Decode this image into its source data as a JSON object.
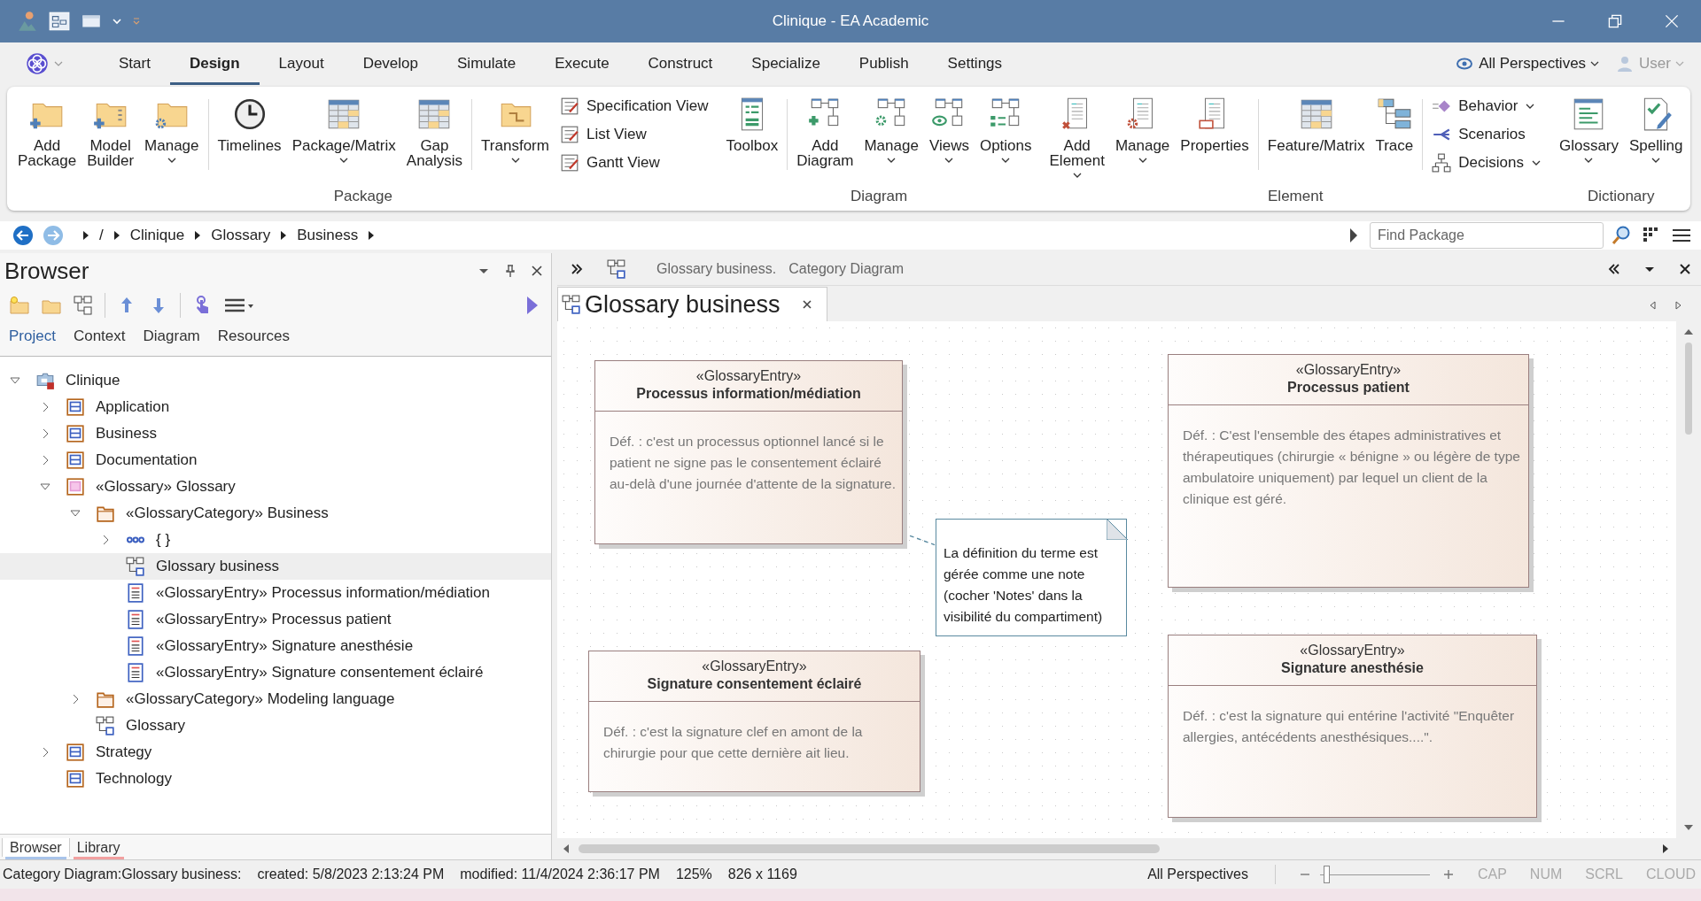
{
  "window": {
    "title": "Clinique - EA Academic"
  },
  "ribbon_tabs": [
    {
      "label": "Start",
      "selected": false
    },
    {
      "label": "Design",
      "selected": true
    },
    {
      "label": "Layout",
      "selected": false
    },
    {
      "label": "Develop",
      "selected": false
    },
    {
      "label": "Simulate",
      "selected": false
    },
    {
      "label": "Execute",
      "selected": false
    },
    {
      "label": "Construct",
      "selected": false
    },
    {
      "label": "Specialize",
      "selected": false
    },
    {
      "label": "Publish",
      "selected": false
    },
    {
      "label": "Settings",
      "selected": false
    }
  ],
  "perspective": "All Perspectives",
  "user": "User",
  "ribbon_groups": [
    {
      "label": "Package",
      "items": [
        {
          "kind": "large",
          "label": "Add Package",
          "menu": false
        },
        {
          "kind": "large",
          "label": "Model Builder",
          "menu": false
        },
        {
          "kind": "large",
          "label": "Manage",
          "menu": true
        },
        {
          "kind": "separator"
        },
        {
          "kind": "large",
          "label": "Timelines",
          "menu": false
        },
        {
          "kind": "large",
          "label": "Package/Matrix",
          "menu": true
        },
        {
          "kind": "large",
          "label": "Gap Analysis",
          "menu": false
        },
        {
          "kind": "separator"
        },
        {
          "kind": "large",
          "label": "Transform",
          "menu": true
        },
        {
          "kind": "stack",
          "items": [
            {
              "label": "Specification View",
              "menu": false
            },
            {
              "label": "List View",
              "menu": false
            },
            {
              "label": "Gantt View",
              "menu": false
            }
          ]
        }
      ]
    },
    {
      "label": "Diagram",
      "items": [
        {
          "kind": "large",
          "label": "Toolbox",
          "menu": false
        },
        {
          "kind": "separator"
        },
        {
          "kind": "large",
          "label": "Add Diagram",
          "menu": false
        },
        {
          "kind": "large",
          "label": "Manage",
          "menu": true
        },
        {
          "kind": "large",
          "label": "Views",
          "menu": true
        },
        {
          "kind": "large",
          "label": "Options",
          "menu": true
        }
      ]
    },
    {
      "label": "Element",
      "items": [
        {
          "kind": "large",
          "label": "Add Element",
          "menu": true
        },
        {
          "kind": "large",
          "label": "Manage",
          "menu": true
        },
        {
          "kind": "large",
          "label": "Properties",
          "menu": false
        },
        {
          "kind": "separator"
        },
        {
          "kind": "large",
          "label": "Feature/Matrix",
          "menu": false
        },
        {
          "kind": "large",
          "label": "Trace",
          "menu": false
        },
        {
          "kind": "separator"
        },
        {
          "kind": "stack",
          "items": [
            {
              "label": "Behavior",
              "menu": true
            },
            {
              "label": "Scenarios",
              "menu": false
            },
            {
              "label": "Decisions",
              "menu": true
            }
          ]
        }
      ]
    },
    {
      "label": "Dictionary",
      "items": [
        {
          "kind": "large",
          "label": "Glossary",
          "menu": true
        },
        {
          "kind": "large",
          "label": "Spelling",
          "menu": true
        }
      ]
    }
  ],
  "breadcrumb": [
    "/",
    "Clinique",
    "Glossary",
    "Business"
  ],
  "find_package": {
    "placeholder": "Find Package"
  },
  "browser": {
    "title": "Browser",
    "tabs": [
      {
        "label": "Project",
        "selected": true
      },
      {
        "label": "Context",
        "selected": false
      },
      {
        "label": "Diagram",
        "selected": false
      },
      {
        "label": "Resources",
        "selected": false
      }
    ],
    "tree": [
      {
        "kind": "model",
        "label": "Clinique",
        "expanded": true,
        "selected": false,
        "children": [
          {
            "kind": "package",
            "label": "Application",
            "expanded": false,
            "selected": false
          },
          {
            "kind": "package",
            "label": "Business",
            "expanded": false,
            "selected": false
          },
          {
            "kind": "package",
            "label": "Documentation",
            "expanded": false,
            "selected": false
          },
          {
            "kind": "glossary",
            "label": "«Glossary» Glossary",
            "expanded": true,
            "selected": false,
            "children": [
              {
                "kind": "category",
                "label": "«GlossaryCategory» Business",
                "expanded": true,
                "selected": false,
                "children": [
                  {
                    "kind": "group",
                    "label": "{ }",
                    "expanded": false,
                    "selected": false
                  },
                  {
                    "kind": "diagram",
                    "label": "Glossary business",
                    "selected": true
                  },
                  {
                    "kind": "entry",
                    "label": "«GlossaryEntry» Processus information/médiation",
                    "selected": false
                  },
                  {
                    "kind": "entry",
                    "label": "«GlossaryEntry» Processus patient",
                    "selected": false
                  },
                  {
                    "kind": "entry",
                    "label": "«GlossaryEntry» Signature anesthésie",
                    "selected": false
                  },
                  {
                    "kind": "entry",
                    "label": "«GlossaryEntry» Signature consentement éclairé",
                    "selected": false
                  }
                ]
              },
              {
                "kind": "category",
                "label": "«GlossaryCategory» Modeling language",
                "expanded": false,
                "selected": false
              },
              {
                "kind": "diagram",
                "label": "Glossary",
                "selected": false
              }
            ]
          },
          {
            "kind": "package",
            "label": "Strategy",
            "expanded": false,
            "selected": false
          },
          {
            "kind": "package",
            "label": "Technology",
            "selected": false
          }
        ]
      }
    ],
    "bottom_tabs": [
      {
        "label": "Browser",
        "selected": true,
        "color": "#a9c4ea"
      },
      {
        "label": "Library",
        "selected": false,
        "color": "#f2a0a0"
      }
    ]
  },
  "diagram": {
    "caption": "Glossary business.",
    "type": "Category Diagram",
    "tab": "Glossary business",
    "entries": [
      {
        "stereotype": "«GlossaryEntry»",
        "name": "Processus information/médiation",
        "definition": "Déf. : c'est un processus optionnel lancé si le patient ne signe pas le consentement éclairé au-delà d'une journée d'attente de la signature."
      },
      {
        "stereotype": "«GlossaryEntry»",
        "name": "Signature consentement éclairé",
        "definition": "Déf. : c'est la signature clef en amont de la chirurgie pour que cette dernière ait lieu."
      },
      {
        "stereotype": "«GlossaryEntry»",
        "name": "Processus patient",
        "definition": "Déf. : C'est l'ensemble des étapes administratives et thérapeutiques (chirurgie « bénigne » ou légère de type ambulatoire uniquement) par lequel un client de la clinique est géré."
      },
      {
        "stereotype": "«GlossaryEntry»",
        "name": "Signature anesthésie",
        "definition": "Déf. : c'est la signature qui entérine l'activité \"Enquêter allergies, antécédents anesthésiques....\"."
      }
    ],
    "note": "La définition du terme est gérée comme une note (cocher 'Notes' dans la visibilité du compartiment)"
  },
  "status_bar": {
    "diagram": "Category Diagram:Glossary business:",
    "created": "created: 5/8/2023 2:13:24 PM",
    "modified": "modified: 11/4/2024 2:36:17 PM",
    "zoom": "125%",
    "size": "826 x 1169",
    "perspective": "All Perspectives",
    "zoom_slider": {
      "level": 0.03
    },
    "indicators": [
      {
        "label": "CAP",
        "on": false
      },
      {
        "label": "NUM",
        "on": false
      },
      {
        "label": "SCRL",
        "on": false
      },
      {
        "label": "CLOUD",
        "on": false
      }
    ]
  }
}
